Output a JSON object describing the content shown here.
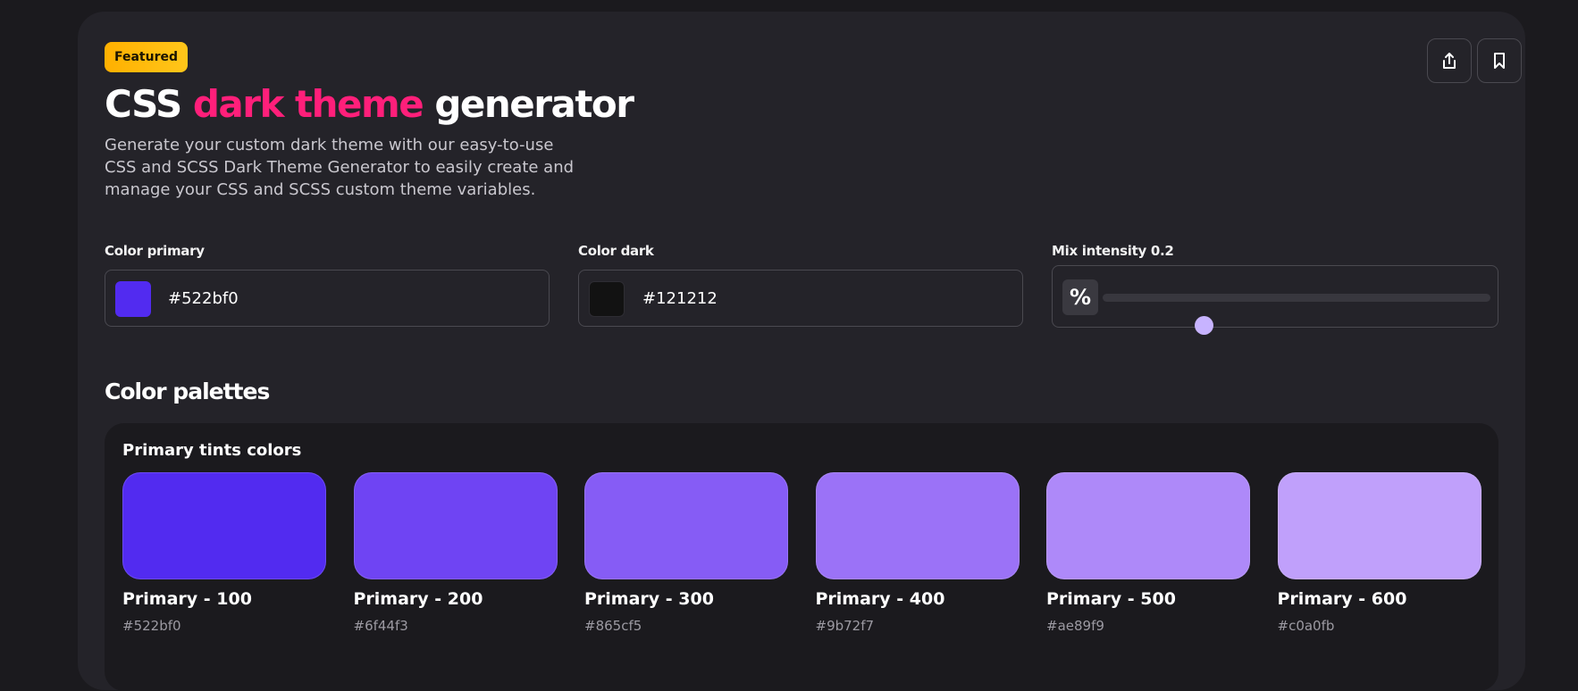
{
  "badge": "Featured",
  "title": {
    "part1": "CSS ",
    "accent": "dark theme",
    "part2": " generator"
  },
  "description": "Generate your custom dark theme with our easy-to-use CSS and SCSS Dark Theme Generator to easily create and manage your CSS and SCSS custom theme variables.",
  "actions": {
    "share_icon": "share-icon",
    "bookmark_icon": "bookmark-icon"
  },
  "fields": {
    "primary": {
      "label": "Color primary",
      "value": "#522bf0",
      "swatch": "#522bf0"
    },
    "dark": {
      "label": "Color dark",
      "value": "#121212",
      "swatch": "#121212"
    },
    "mix": {
      "label": "Mix intensity 0.2",
      "icon": "%",
      "value": 0.2
    }
  },
  "palettes_title": "Color palettes",
  "palette": {
    "title": "Primary tints colors",
    "items": [
      {
        "name": "Primary - 100",
        "hex": "#522bf0"
      },
      {
        "name": "Primary - 200",
        "hex": "#6f44f3"
      },
      {
        "name": "Primary - 300",
        "hex": "#865cf5"
      },
      {
        "name": "Primary - 400",
        "hex": "#9b72f7"
      },
      {
        "name": "Primary - 500",
        "hex": "#ae89f9"
      },
      {
        "name": "Primary - 600",
        "hex": "#c0a0fb"
      }
    ]
  },
  "colors": {
    "accent": "#ff1f7a",
    "badge": "#ffb000",
    "slider_thumb": "#c7b3ff"
  }
}
